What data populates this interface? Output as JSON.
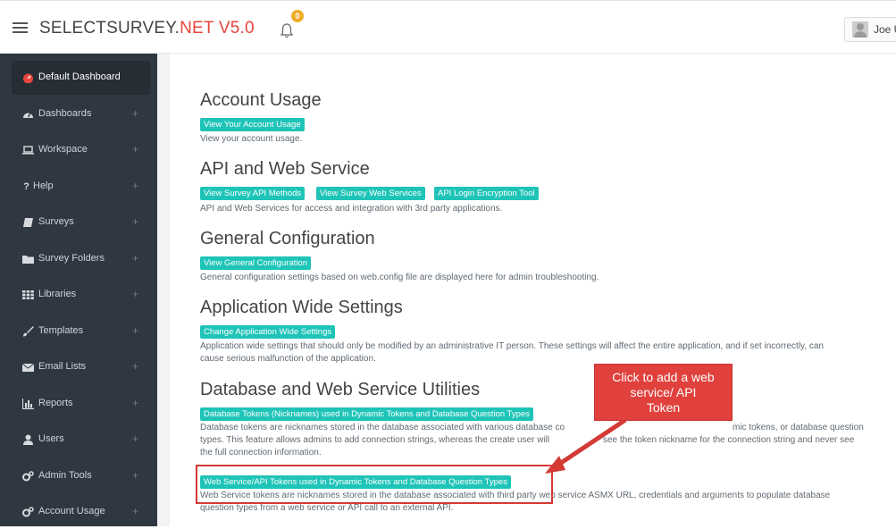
{
  "header": {
    "brand_prefix": "SELECTSURVEY.",
    "brand_suffix": "NET V5.0",
    "notification_count": "0",
    "user_name": "Joe U"
  },
  "sidebar": {
    "items": [
      {
        "label": "Default Dashboard",
        "icon": "dashboard-gauge-icon"
      },
      {
        "label": "Dashboards",
        "icon": "tachometer-icon"
      },
      {
        "label": "Workspace",
        "icon": "laptop-icon"
      },
      {
        "label": "Help",
        "icon": "question-icon"
      },
      {
        "label": "Surveys",
        "icon": "book-icon"
      },
      {
        "label": "Survey Folders",
        "icon": "folder-icon"
      },
      {
        "label": "Libraries",
        "icon": "grid-icon"
      },
      {
        "label": "Templates",
        "icon": "brush-icon"
      },
      {
        "label": "Email Lists",
        "icon": "envelope-icon"
      },
      {
        "label": "Reports",
        "icon": "bar-chart-icon"
      },
      {
        "label": "Users",
        "icon": "user-icon"
      },
      {
        "label": "Admin Tools",
        "icon": "cogs-icon"
      },
      {
        "label": "Account Usage",
        "icon": "cogs-icon"
      }
    ]
  },
  "sections": {
    "account_usage": {
      "title": "Account Usage",
      "button": "View Your Account Usage",
      "desc": "View your account usage."
    },
    "api": {
      "title": "API and Web Service",
      "btn1": "View Survey API Methods",
      "btn2": "View Survey Web Services",
      "btn3": "API Login Encryption Tool",
      "desc": "API and Web Services for access and integration with 3rd party applications."
    },
    "general": {
      "title": "General Configuration",
      "button": "View General Configuration",
      "desc": "General configuration settings based on web.config file are displayed here for admin troubleshooting."
    },
    "appwide": {
      "title": "Application Wide Settings",
      "button": "Change Application Wide Settings",
      "desc1": "Application wide settings that should only be modified by an administrative IT person. These settings will affect the entire application, and if set incorrectly, can",
      "desc2": "cause serious malfunction of the application."
    },
    "db": {
      "title": "Database and Web Service Utilities",
      "btn_db": "Database Tokens (Nicknames) used in Dynamic Tokens and Database Question Types",
      "db_desc1": "Database tokens are nicknames stored in the database associated with various database co",
      "db_desc1b": "mic tokens, or database question",
      "db_desc2": "types. This feature allows admins to add connection strings, whereas the create user will",
      "db_desc2b": "see the token nickname for the connection string and never see",
      "db_desc3": "the full connection information.",
      "btn_ws": "Web Service/API Tokens used in Dynamic Tokens and Database Question Types",
      "ws_desc1": "Web Service tokens are nicknames stored in the database associated with third party web service ASMX URL, credentials and arguments to populate database",
      "ws_desc2": "question types from a web service or API call to an external API."
    }
  },
  "callout": {
    "line1": "Click to add a web",
    "line2": "service/ API",
    "line3": "Token"
  },
  "colors": {
    "brand_accent": "#e8453c",
    "button_teal": "#1fc4b8",
    "sidebar_bg": "#2f3741",
    "callout_red": "#e0413c"
  }
}
